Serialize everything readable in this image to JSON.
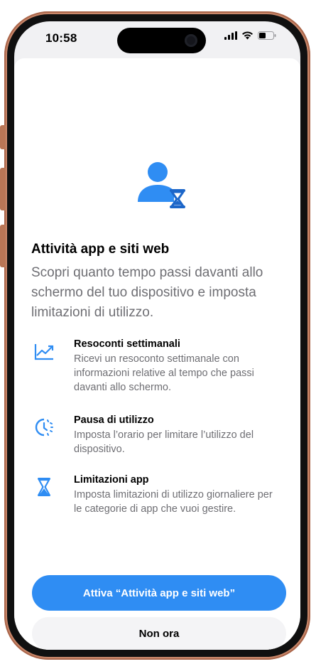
{
  "status_bar": {
    "time": "10:58",
    "icons": [
      "cellular-signal-icon",
      "wifi-icon",
      "battery-icon"
    ]
  },
  "hero": {
    "icon": "person-hourglass-icon"
  },
  "title": "Attività app e siti web",
  "subtitle": "Scopri quanto tempo passi davanti allo schermo del tuo dispositivo e imposta limitazioni di utilizzo.",
  "features": [
    {
      "icon": "chart-trend-icon",
      "title": "Resoconti settimanali",
      "description": "Ricevi un resoconto settimanale con informazioni relative al tempo che passi davanti allo schermo."
    },
    {
      "icon": "downtime-clock-icon",
      "title": "Pausa di utilizzo",
      "description": "Imposta l’orario per limitare l’utilizzo del dispositivo."
    },
    {
      "icon": "hourglass-icon",
      "title": "Limitazioni app",
      "description": "Imposta limitazioni di utilizzo giornaliere per le categorie di app che vuoi gestire."
    }
  ],
  "buttons": {
    "primary": "Attiva “Attività app e siti web”",
    "secondary": "Non ora"
  },
  "colors": {
    "accent": "#2f8df3",
    "phone_frame": "#c9876a",
    "secondary_text": "#6e6e73"
  }
}
